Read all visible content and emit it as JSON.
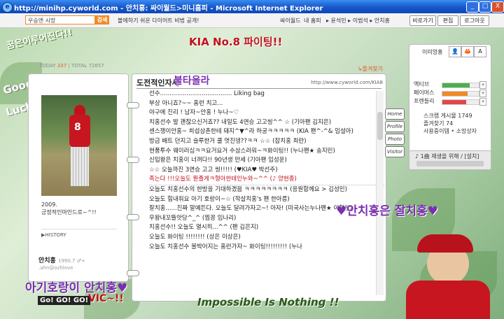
{
  "window": {
    "title": "http://minihp.cyworld.com - 안치홍: 싸이월드>미니홈피 - Microsoft Internet Explorer",
    "minimize": "_",
    "maximize": "□",
    "close": "X"
  },
  "topbar": {
    "search_value": "우승엔 시망",
    "search_button": "검색",
    "promo": "볼에하기 쉬운 다이어트 비법 공개!",
    "nav_links": [
      "싸이월드",
      "내 홈피"
    ],
    "friends": "▸ 윤석민 ▸ 이범석 ▸ 안치홍",
    "buttons": [
      "비로가기",
      "편집",
      "로그아웃"
    ]
  },
  "deco": {
    "dream": "꿈은이루어진다!!",
    "kia": "KIA No.8 파이팅!!",
    "good": "Good",
    "luck": "Luck",
    "burning": "불타올라",
    "bottom_left": "아기호랑이 안치홍♥",
    "gogo": "Go! GO! GO!",
    "vic": "VIC~!!",
    "impossible": "Impossible Is Nothing !!",
    "right_heart": "♥안치홍은 잘치홍♥"
  },
  "left": {
    "today_label": "TODAY",
    "today_value": "337",
    "total_label": "TOTAL",
    "total_value": "72657",
    "uniform_number": "8",
    "caption_year": "2009.",
    "caption_text": "긍정적인마인드로~^!!",
    "history": "▶HISTORY",
    "owner": "안치홍",
    "owner_info": "1990.7 ♂+",
    "email": ".ahn@ozhlove"
  },
  "main": {
    "title": "도전적인자세",
    "guestbook": "↳즐겨찾기",
    "url": "http://www.cyworld.com/KIA8",
    "items": [
      "선수...................................... Liking bag",
      "부상 아니죠?~~ 홈런 치고...",
      "야구에 진리 ! 남자~안홍 ! 누나~♡",
      "치홍선수 발 괜찮으신거죠?? 내일도 4연승 고고씽^^ ☆ (기아팬 김지은)",
      "센스쟁이안홍~ 희섭삼촌한테 돼지^▼^라 하궁ㅋㅋㅋㅋㅋ (KIA 팬^-^& 임설아)",
      "방금 배트 던지고 슬루한거 쿨 멋진뎅??ㅋㅋ ☆☆ (잡치홍 최란)",
      "현풍투수 웨이러심ㅋㅋ요거요거 수삼스러워~ㅋ화이팅!! (누나팬★ 송지민)",
      "신입왕은 치홍이 너꺼다!! 90년생 만세 (기아팬 임성운)",
      "☆☆ 오늘까진 3연승 고고 씽!!!!! (♥KIA♥ 박선주)",
      "족는다 !!!오늘도 뭔졸게ㅋ형아한테인누와~^^ (♪ 양현종)",
      "오늘도 치홍선수의 한방을 기대하겠음 ㅋㅋㅋㅋㅋㅋㅋㅋ (응원함께요 > 김성민)",
      "오늘도 힘내줘요 아기 호랑이~☆ (작살치홍's 팬 한아름)",
      "잘치홍......진짜 말예든다. 오늘도 달려가자고~! 아자! (미국사는누나팬★ 이향림)",
      "우왕내꼬뜰앗당^_^ (찜꽁 임나리)",
      "치홍선수!! 오늘도 열시히...^^ (팬 김은지)",
      "오늘도 화이팅 !!!!!!!! (상은 이상은)",
      "오늘도 치홍선수 볼박어지는 홈런가자~ 화이팅!!!!!!!!! (누나"
    ]
  },
  "sidetabs": [
    "Home",
    "Profile",
    "Photo",
    "Visitor"
  ],
  "right": {
    "title": "이미엉홍",
    "icons": [
      "👤",
      "🦀",
      "A"
    ],
    "bars": [
      {
        "label": "액티브",
        "level": 0.75,
        "color": "#4caf50"
      },
      {
        "label": "페이머스",
        "level": 0.7,
        "color": "#f08a24"
      },
      {
        "label": "프렌들리",
        "level": 0.65,
        "color": "#e04848"
      }
    ],
    "scrap": "스크랩 게시물 1749",
    "scrap_label": "즐겨찾기 74",
    "scrap_count": "사용중이템 • 소망상자",
    "music": "♪ 1曲 재생을 위해 / [설치]"
  }
}
